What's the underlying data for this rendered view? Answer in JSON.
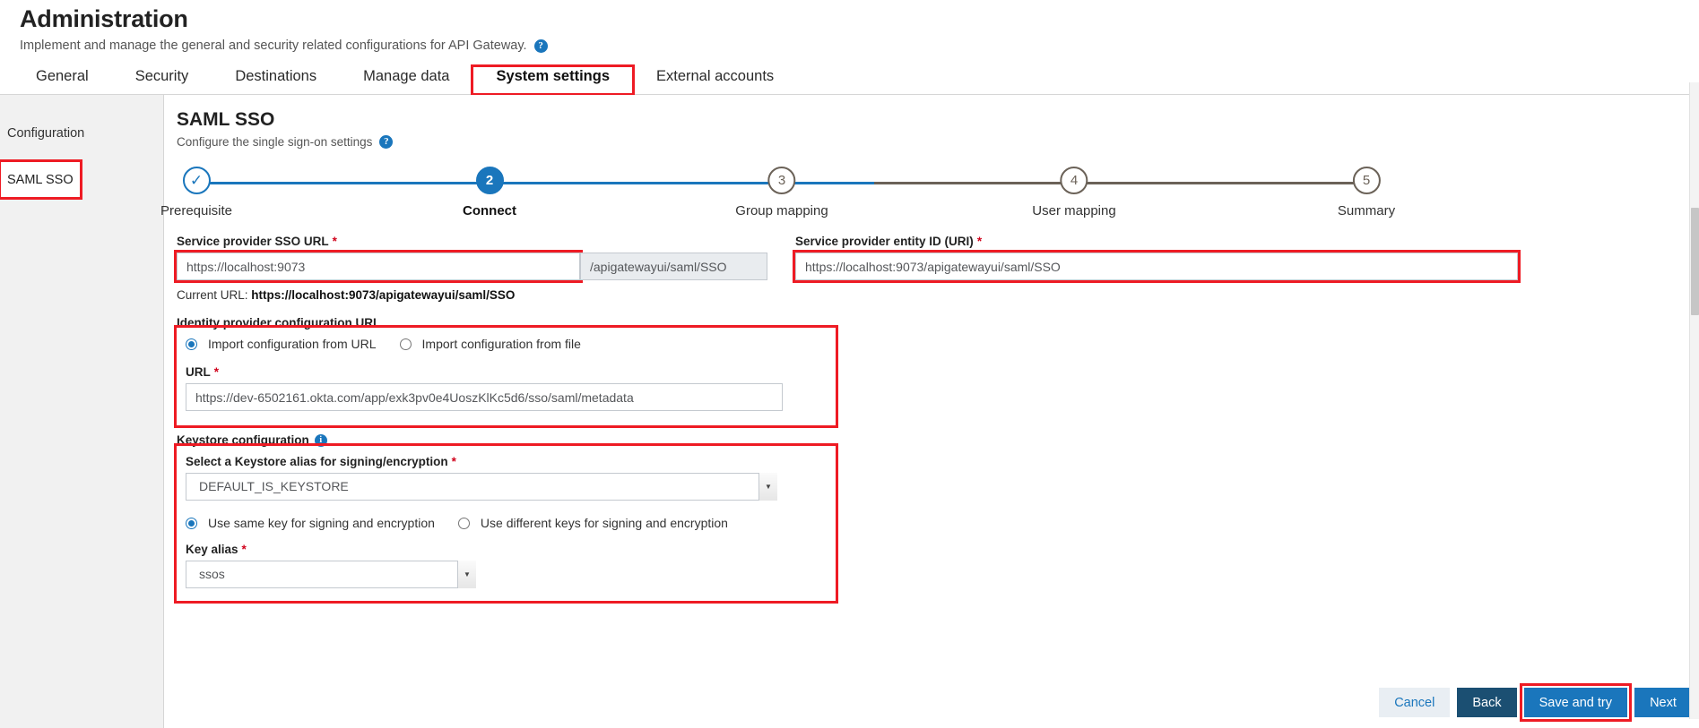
{
  "header": {
    "title": "Administration",
    "subtitle": "Implement and manage the general and security related configurations for API Gateway.",
    "help_icon": "help-icon"
  },
  "tabs": [
    {
      "label": "General",
      "active": false
    },
    {
      "label": "Security",
      "active": false
    },
    {
      "label": "Destinations",
      "active": false
    },
    {
      "label": "Manage data",
      "active": false
    },
    {
      "label": "System settings",
      "active": true
    },
    {
      "label": "External accounts",
      "active": false
    }
  ],
  "sidebar": {
    "title": "Configuration",
    "items": [
      {
        "label": "SAML SSO",
        "selected": true
      }
    ]
  },
  "main": {
    "title": "SAML SSO",
    "subtitle": "Configure the single sign-on settings",
    "help_icon": "help-icon"
  },
  "stepper": {
    "steps": [
      {
        "number": "1",
        "label": "Prerequisite",
        "state": "done",
        "glyph": "✓"
      },
      {
        "number": "2",
        "label": "Connect",
        "state": "current"
      },
      {
        "number": "3",
        "label": "Group mapping",
        "state": "todo"
      },
      {
        "number": "4",
        "label": "User mapping",
        "state": "todo"
      },
      {
        "number": "5",
        "label": "Summary",
        "state": "todo"
      }
    ]
  },
  "form": {
    "sso_url": {
      "label": "Service provider SSO URL",
      "required": "*",
      "value": "https://localhost:9073",
      "suffix": "/apigatewayui/saml/SSO"
    },
    "entity_id": {
      "label": "Service provider entity ID (URI)",
      "required": "*",
      "value": "https://localhost:9073/apigatewayui/saml/SSO"
    },
    "current_url": {
      "prefix": "Current URL: ",
      "value": "https://localhost:9073/apigatewayui/saml/SSO"
    },
    "idp_config": {
      "group_label": "Identity provider configuration URL",
      "radio_url": "Import configuration from URL",
      "radio_file": "Import configuration from file",
      "selected": "url",
      "url_label": "URL",
      "url_required": "*",
      "url_value": "https://dev-6502161.okta.com/app/exk3pv0e4UoszKlKc5d6/sso/saml/metadata"
    },
    "keystore": {
      "group_label": "Keystore configuration",
      "info_icon": "info-icon",
      "alias_label": "Select a Keystore alias for signing/encryption",
      "alias_required": "*",
      "alias_value": "DEFAULT_IS_KEYSTORE",
      "radio_same": "Use same key for signing and encryption",
      "radio_diff": "Use different keys for signing and encryption",
      "selected": "same",
      "key_alias_label": "Key alias",
      "key_alias_required": "*",
      "key_alias_value": "ssos"
    }
  },
  "footer": {
    "cancel": "Cancel",
    "back": "Back",
    "save_and_try": "Save and try",
    "next": "Next"
  },
  "colors": {
    "accent": "#1a76bc",
    "highlight": "#ee1b24",
    "dark_button": "#1b4f72",
    "required": "#d0021b"
  }
}
